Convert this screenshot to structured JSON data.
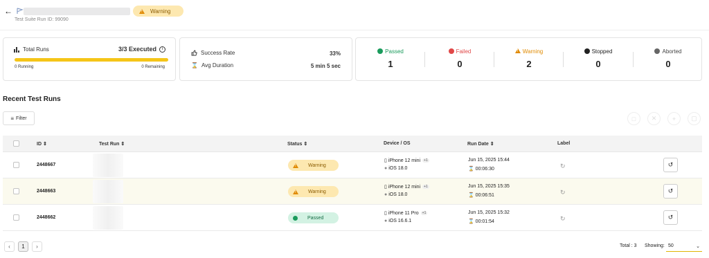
{
  "header": {
    "status_badge": "Warning",
    "run_id": "Test Suite Run ID: 99090"
  },
  "summary": {
    "total_runs_label": "Total Runs",
    "executed": "3/3 Executed",
    "running": "0 Running",
    "remaining": "0 Remaining",
    "progress": 1.0,
    "success_rate_label": "Success Rate",
    "success_rate": "33%",
    "avg_duration_label": "Avg Duration",
    "avg_duration": "5 min 5 sec",
    "stats": [
      {
        "label": "Passed",
        "value": "1",
        "color": "#1a9b5c",
        "icon": "check-circle-icon"
      },
      {
        "label": "Failed",
        "value": "0",
        "color": "#e04848",
        "icon": "x-circle-icon"
      },
      {
        "label": "Warning",
        "value": "2",
        "color": "#e08a00",
        "icon": "warning-triangle-icon"
      },
      {
        "label": "Stopped",
        "value": "0",
        "color": "#222222",
        "icon": "stop-circle-icon"
      },
      {
        "label": "Aborted",
        "value": "0",
        "color": "#666666",
        "icon": "minus-circle-icon"
      }
    ]
  },
  "section": {
    "title": "Recent Test Runs",
    "filter_label": "Filter"
  },
  "table": {
    "headers": {
      "id": "ID",
      "test_run": "Test Run",
      "status": "Status",
      "device_os": "Device / OS",
      "run_date": "Run Date",
      "label": "Label"
    },
    "rows": [
      {
        "id": "2448667",
        "status": "Warning",
        "device": "iPhone 12 mini",
        "device_extra": "+1",
        "os": "iOS 18.0",
        "date": "Jun 15, 2025 15:44",
        "duration": "00:06:30"
      },
      {
        "id": "2448663",
        "status": "Warning",
        "device": "iPhone 12 mini",
        "device_extra": "+1",
        "os": "iOS 18.0",
        "date": "Jun 15, 2025 15:35",
        "duration": "00:06:51"
      },
      {
        "id": "2448662",
        "status": "Passed",
        "device": "iPhone 11 Pro",
        "device_extra": "+1",
        "os": "iOS 16.6.1",
        "date": "Jun 15, 2025 15:32",
        "duration": "00:01:54"
      }
    ]
  },
  "footer": {
    "page": "1",
    "total": "Total : 3",
    "showing_label": "Showing:",
    "page_size": "50"
  }
}
